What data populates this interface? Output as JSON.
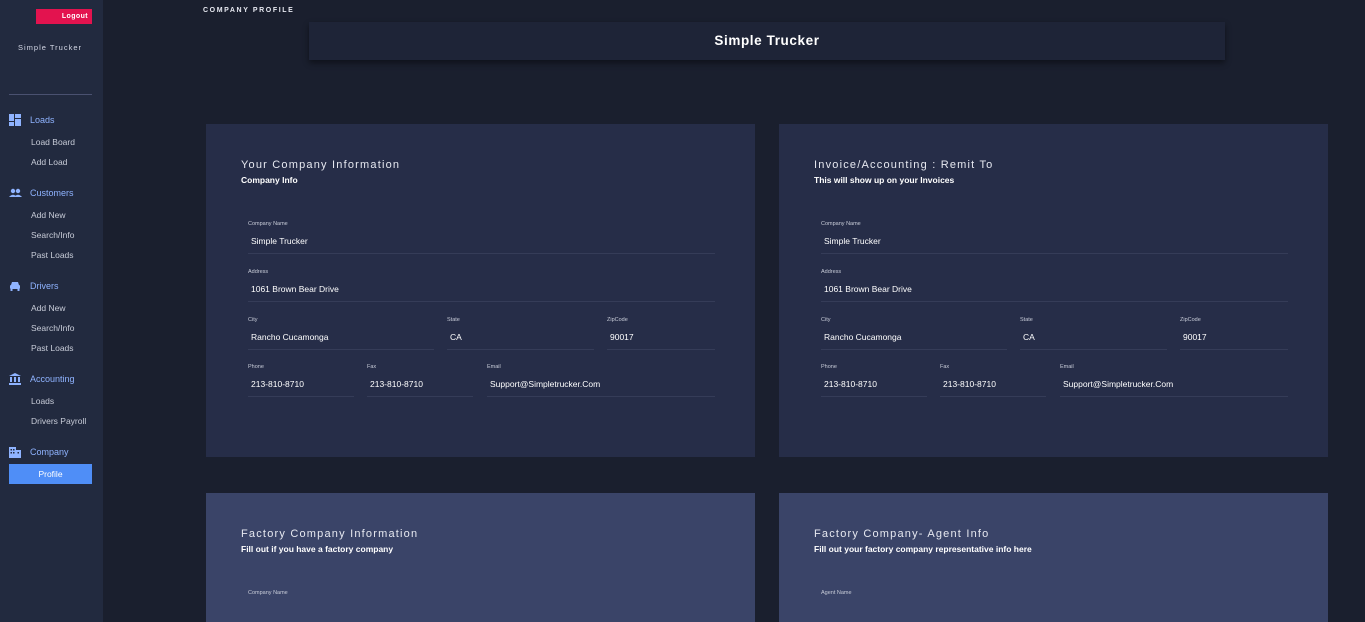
{
  "header": {
    "logout_label": "Logout",
    "brand": "Simple Trucker",
    "page_label": "COMPANY PROFILE",
    "company_title": "Simple Trucker"
  },
  "sidebar": {
    "sections": [
      {
        "label": "Loads",
        "icon": "dashboard-icon",
        "items": [
          "Load Board",
          "Add Load"
        ]
      },
      {
        "label": "Customers",
        "icon": "people-icon",
        "items": [
          "Add New",
          "Search/Info",
          "Past Loads"
        ]
      },
      {
        "label": "Drivers",
        "icon": "car-icon",
        "items": [
          "Add New",
          "Search/Info",
          "Past Loads"
        ]
      },
      {
        "label": "Accounting",
        "icon": "bank-icon",
        "items": [
          "Loads",
          "Drivers Payroll"
        ]
      },
      {
        "label": "Company",
        "icon": "building-icon",
        "items": [
          "Profile"
        ]
      }
    ],
    "active_item": "Profile"
  },
  "cards": {
    "company_info": {
      "title": "Your Company Information",
      "subtitle": "Company Info",
      "labels": {
        "company_name": "Company Name",
        "address": "Address",
        "city": "City",
        "state": "State",
        "zip": "ZipCode",
        "phone": "Phone",
        "fax": "Fax",
        "email": "Email"
      },
      "values": {
        "company_name": "Simple Trucker",
        "address": "1061  Brown Bear Drive",
        "city": "Rancho Cucamonga",
        "state": "CA",
        "zip": "90017",
        "phone": "213-810-8710",
        "fax": "213-810-8710",
        "email": "Support@Simpletrucker.Com"
      }
    },
    "invoice_info": {
      "title": "Invoice/Accounting : Remit To",
      "subtitle": "This will show up on your Invoices",
      "labels": {
        "company_name": "Company Name",
        "address": "Address",
        "city": "City",
        "state": "State",
        "zip": "ZipCode",
        "phone": "Phone",
        "fax": "Fax",
        "email": "Email"
      },
      "values": {
        "company_name": "Simple Trucker",
        "address": "1061  Brown Bear Drive",
        "city": "Rancho Cucamonga",
        "state": "CA",
        "zip": "90017",
        "phone": "213-810-8710",
        "fax": "213-810-8710",
        "email": "Support@Simpletrucker.Com"
      }
    },
    "factory_info": {
      "title": "Factory Company Information",
      "subtitle": "Fill out if you have a factory company",
      "labels": {
        "company_name": "Company Name"
      }
    },
    "factory_agent": {
      "title": "Factory Company- Agent Info",
      "subtitle": "Fill out your factory company representative info here",
      "labels": {
        "agent_name": "Agent Name"
      }
    }
  },
  "colors": {
    "accent": "#4f8ef7",
    "logout": "#e3134f",
    "background": "#1a1f2e",
    "sidebar": "#222a3f"
  }
}
